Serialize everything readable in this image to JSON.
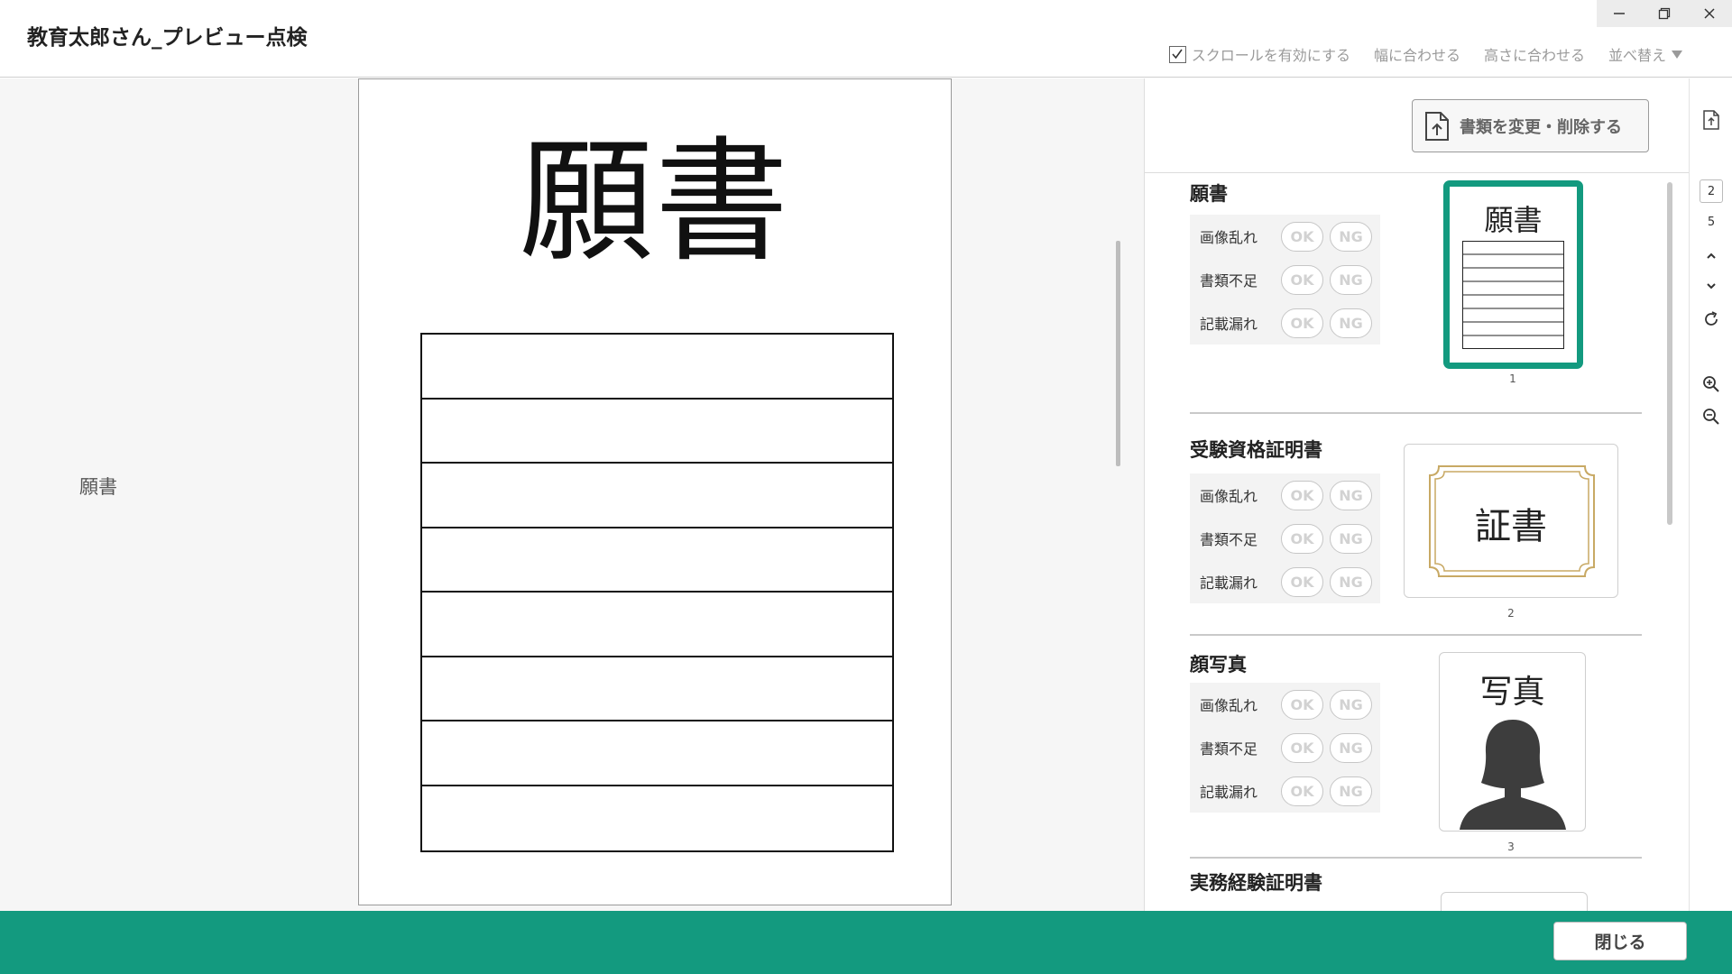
{
  "window": {
    "title": "教育太郎さん_プレビュー点検",
    "controls": [
      "minimize-icon",
      "restore-icon",
      "close-icon"
    ]
  },
  "toolbar": {
    "scroll_label": "スクロールを有効にする",
    "scroll_checked": true,
    "fit_width_label": "幅に合わせる",
    "fit_height_label": "高さに合わせる",
    "sort_label": "並べ替え"
  },
  "left_pane": {
    "label": "願書"
  },
  "viewer": {
    "page_title": "願書",
    "table_rows": 8
  },
  "panel": {
    "change_button_label": "書類を変更・削除する",
    "ok_label": "OK",
    "ng_label": "NG",
    "documents": [
      {
        "title": "願書",
        "checks": [
          "画像乱れ",
          "書類不足",
          "記載漏れ"
        ],
        "thumb_text": "願書",
        "thumb_number": "1",
        "selected": true
      },
      {
        "title": "受験資格証明書",
        "checks": [
          "画像乱れ",
          "書類不足",
          "記載漏れ"
        ],
        "thumb_text": "証書",
        "thumb_number": "2",
        "selected": false
      },
      {
        "title": "顔写真",
        "checks": [
          "画像乱れ",
          "書類不足",
          "記載漏れ"
        ],
        "thumb_text": "写真",
        "thumb_number": "3",
        "selected": false
      },
      {
        "title": "実務経験証明書"
      }
    ]
  },
  "side_tools": {
    "current_page": "2",
    "total_pages": "5"
  },
  "footer": {
    "close_label": "閉じる"
  },
  "colors": {
    "accent": "#139a7f",
    "certificate_gold": "#c8a964",
    "photo_silhouette": "#3d3d3d"
  }
}
